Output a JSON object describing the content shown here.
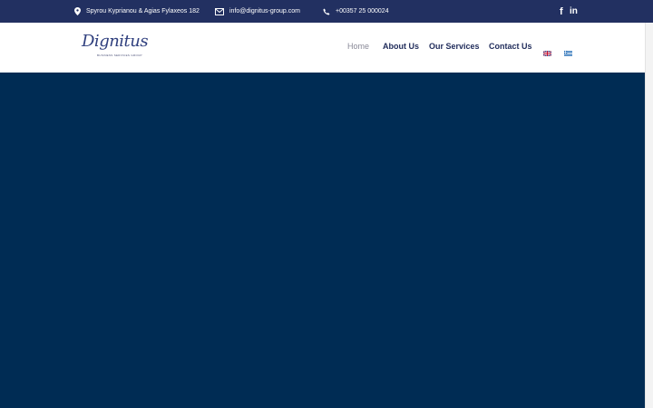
{
  "topbar": {
    "address": "Spyrou Kyprianou & Agias Fylaxeos 182",
    "email": "info@dignitus-group.com",
    "phone": "+00357 25 000024",
    "social": {
      "facebook": "f",
      "linkedin": "in"
    }
  },
  "header": {
    "logo": {
      "name": "Dignitus",
      "tagline": "BUSINESS SERVICES GROUP"
    },
    "nav": [
      "Home",
      "About Us",
      "Our Services",
      "Contact Us"
    ],
    "languages": [
      "English",
      "Greek"
    ]
  },
  "colors": {
    "topbar_bg": "#223061",
    "hero_bg": "#002c54",
    "nav_text": "#1f2b5a",
    "nav_active": "#8a8a98"
  }
}
